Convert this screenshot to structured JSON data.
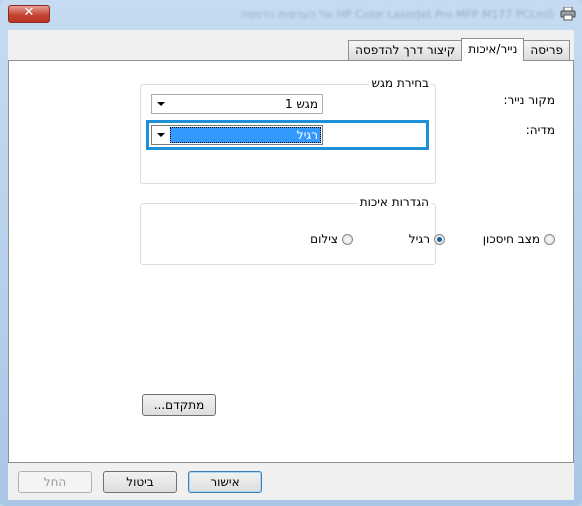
{
  "window": {
    "title": "HP Color LaserJet Pro MFP M177 PCLmS של העדפות הדפסה",
    "close_glyph": "✕"
  },
  "tabs": [
    {
      "label": "פריסה",
      "active": false
    },
    {
      "label": "נייר/איכות",
      "active": true
    },
    {
      "label": "קיצור דרך להדפסה",
      "active": false
    }
  ],
  "tray_selection": {
    "legend": "בחירת מגש",
    "paper_source_label": "מקור נייר:",
    "paper_source_value": "מגש 1",
    "media_label": "מדיה:",
    "media_value": "רגיל"
  },
  "quality_settings": {
    "legend": "הגדרות איכות",
    "options": [
      {
        "label": "מצב חיסכון",
        "selected": false
      },
      {
        "label": "רגיל",
        "selected": true
      },
      {
        "label": "צילום",
        "selected": false
      }
    ]
  },
  "advanced_button_label": "מתקדם...",
  "footer": {
    "ok_label": "אישור",
    "cancel_label": "ביטול",
    "apply_label": "החל"
  },
  "colors": {
    "selection": "#3399ff",
    "focus": "#1e90d8"
  }
}
